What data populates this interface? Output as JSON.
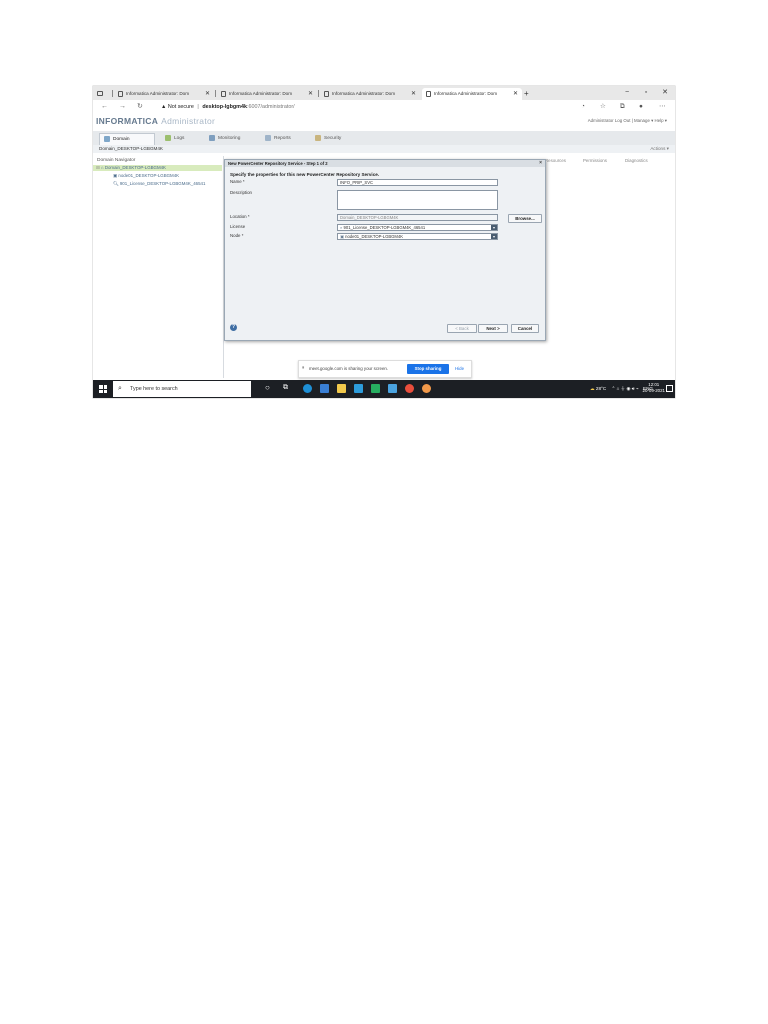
{
  "browser": {
    "tabs": [
      {
        "label": "Informatica Administrator: Dom"
      },
      {
        "label": "Informatica Administrator: Dom"
      },
      {
        "label": "Informatica Administrator: Dom"
      },
      {
        "label": "Informatica Administrator: Dom"
      }
    ],
    "not_secure": "Not secure",
    "url_host": "desktop-lgbgm4k",
    "url_rest": ":6007/administrator/"
  },
  "app": {
    "brand": "INFORMATICA",
    "product": "Administrator",
    "user_menu": "Administrator  Log Out  |  Manage ▾  Help ▾"
  },
  "main_tabs": [
    {
      "label": "Domain"
    },
    {
      "label": "Logs"
    },
    {
      "label": "Monitoring"
    },
    {
      "label": "Reports"
    },
    {
      "label": "Security"
    }
  ],
  "domain_bar": {
    "label": "Domain_DESKTOP-LGBGM4K",
    "actions": "Actions ▾"
  },
  "navigator": {
    "title": "Domain Navigator",
    "items": [
      {
        "label": "Domain_DESKTOP-LGBGM4K"
      },
      {
        "label": "node01_DESKTOP-LGBGM4K"
      },
      {
        "label": "901_License_DESKTOP-LGBGM4K_46541"
      }
    ]
  },
  "content_columns": [
    "Resources",
    "Permissions",
    "Diagnostics"
  ],
  "dialog": {
    "title": "New PowerCenter Repository Service - Step 1 of 2",
    "heading": "Specify the properties for this new PowerCenter Repository Service.",
    "fields": {
      "name_label": "Name *",
      "name_value": "INFO_PRIP_SVC",
      "description_label": "Description",
      "description_value": "",
      "location_label": "Location *",
      "location_value": "Domain_DESKTOP-LGBGM4K",
      "license_label": "License",
      "license_value": "901_License_DESKTOP-LGBGM4K_46541",
      "node_label": "Node *",
      "node_value": "node01_DESKTOP-LGBGM4K"
    },
    "browse": "Browse...",
    "back": "< Back",
    "next": "Next >",
    "cancel": "Cancel"
  },
  "share_bar": {
    "text": "meet.google.com is sharing your screen.",
    "stop": "Stop sharing",
    "hide": "Hide"
  },
  "taskbar": {
    "search_placeholder": "Type here to search",
    "weather": "28°C",
    "lang": "ENG",
    "time": "12:01",
    "date": "20-09-2021"
  }
}
